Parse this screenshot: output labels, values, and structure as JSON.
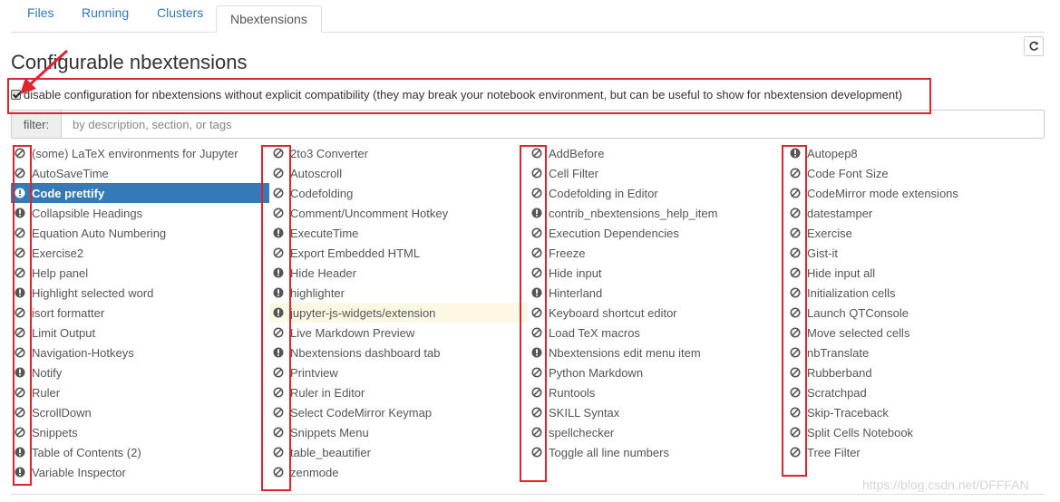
{
  "tabs": [
    {
      "label": "Files",
      "active": false
    },
    {
      "label": "Running",
      "active": false
    },
    {
      "label": "Clusters",
      "active": false
    },
    {
      "label": "Nbextensions",
      "active": true
    }
  ],
  "page_title": "Configurable nbextensions",
  "compat_checkbox": {
    "checked": true,
    "label": "disable configuration for nbextensions without explicit compatibility (they may break your notebook environment, but can be useful to show for nbextension development)"
  },
  "filter": {
    "label": "filter:",
    "placeholder": "by description, section, or tags"
  },
  "colors": {
    "link": "#337ab7",
    "selected": "#337ab7",
    "annotation": "#e0242d",
    "hover": "#fcf8e3"
  },
  "columns": [
    [
      {
        "label": "(some) LaTeX environments for Jupyter",
        "status": "disabled"
      },
      {
        "label": "AutoSaveTime",
        "status": "disabled"
      },
      {
        "label": "Code prettify",
        "status": "warning",
        "selected": true
      },
      {
        "label": "Collapsible Headings",
        "status": "warning"
      },
      {
        "label": "Equation Auto Numbering",
        "status": "disabled"
      },
      {
        "label": "Exercise2",
        "status": "disabled"
      },
      {
        "label": "Help panel",
        "status": "disabled"
      },
      {
        "label": "Highlight selected word",
        "status": "warning"
      },
      {
        "label": "isort formatter",
        "status": "disabled"
      },
      {
        "label": "Limit Output",
        "status": "disabled"
      },
      {
        "label": "Navigation-Hotkeys",
        "status": "disabled"
      },
      {
        "label": "Notify",
        "status": "warning"
      },
      {
        "label": "Ruler",
        "status": "disabled"
      },
      {
        "label": "ScrollDown",
        "status": "disabled"
      },
      {
        "label": "Snippets",
        "status": "disabled"
      },
      {
        "label": "Table of Contents (2)",
        "status": "warning"
      },
      {
        "label": "Variable Inspector",
        "status": "warning"
      }
    ],
    [
      {
        "label": "2to3 Converter",
        "status": "disabled"
      },
      {
        "label": "Autoscroll",
        "status": "disabled"
      },
      {
        "label": "Codefolding",
        "status": "disabled"
      },
      {
        "label": "Comment/Uncomment Hotkey",
        "status": "disabled"
      },
      {
        "label": "ExecuteTime",
        "status": "warning"
      },
      {
        "label": "Export Embedded HTML",
        "status": "disabled"
      },
      {
        "label": "Hide Header",
        "status": "warning"
      },
      {
        "label": "highlighter",
        "status": "warning"
      },
      {
        "label": "jupyter-js-widgets/extension",
        "status": "warning",
        "hover": true
      },
      {
        "label": "Live Markdown Preview",
        "status": "disabled"
      },
      {
        "label": "Nbextensions dashboard tab",
        "status": "warning"
      },
      {
        "label": "Printview",
        "status": "disabled"
      },
      {
        "label": "Ruler in Editor",
        "status": "disabled"
      },
      {
        "label": "Select CodeMirror Keymap",
        "status": "disabled"
      },
      {
        "label": "Snippets Menu",
        "status": "disabled"
      },
      {
        "label": "table_beautifier",
        "status": "disabled"
      },
      {
        "label": "zenmode",
        "status": "disabled"
      }
    ],
    [
      {
        "label": "AddBefore",
        "status": "disabled"
      },
      {
        "label": "Cell Filter",
        "status": "disabled"
      },
      {
        "label": "Codefolding in Editor",
        "status": "disabled"
      },
      {
        "label": "contrib_nbextensions_help_item",
        "status": "warning"
      },
      {
        "label": "Execution Dependencies",
        "status": "disabled"
      },
      {
        "label": "Freeze",
        "status": "disabled"
      },
      {
        "label": "Hide input",
        "status": "disabled"
      },
      {
        "label": "Hinterland",
        "status": "warning"
      },
      {
        "label": "Keyboard shortcut editor",
        "status": "disabled"
      },
      {
        "label": "Load TeX macros",
        "status": "disabled"
      },
      {
        "label": "Nbextensions edit menu item",
        "status": "warning"
      },
      {
        "label": "Python Markdown",
        "status": "disabled"
      },
      {
        "label": "Runtools",
        "status": "disabled"
      },
      {
        "label": "SKILL Syntax",
        "status": "disabled"
      },
      {
        "label": "spellchecker",
        "status": "disabled"
      },
      {
        "label": "Toggle all line numbers",
        "status": "disabled"
      }
    ],
    [
      {
        "label": "Autopep8",
        "status": "warning"
      },
      {
        "label": "Code Font Size",
        "status": "disabled"
      },
      {
        "label": "CodeMirror mode extensions",
        "status": "disabled"
      },
      {
        "label": "datestamper",
        "status": "disabled"
      },
      {
        "label": "Exercise",
        "status": "disabled"
      },
      {
        "label": "Gist-it",
        "status": "disabled"
      },
      {
        "label": "Hide input all",
        "status": "disabled"
      },
      {
        "label": "Initialization cells",
        "status": "disabled"
      },
      {
        "label": "Launch QTConsole",
        "status": "disabled"
      },
      {
        "label": "Move selected cells",
        "status": "disabled"
      },
      {
        "label": "nbTranslate",
        "status": "disabled"
      },
      {
        "label": "Rubberband",
        "status": "disabled"
      },
      {
        "label": "Scratchpad",
        "status": "disabled"
      },
      {
        "label": "Skip-Traceback",
        "status": "disabled"
      },
      {
        "label": "Split Cells Notebook",
        "status": "disabled"
      },
      {
        "label": "Tree Filter",
        "status": "disabled"
      }
    ]
  ],
  "watermark": "https://blog.csdn.net/DFFFAN"
}
